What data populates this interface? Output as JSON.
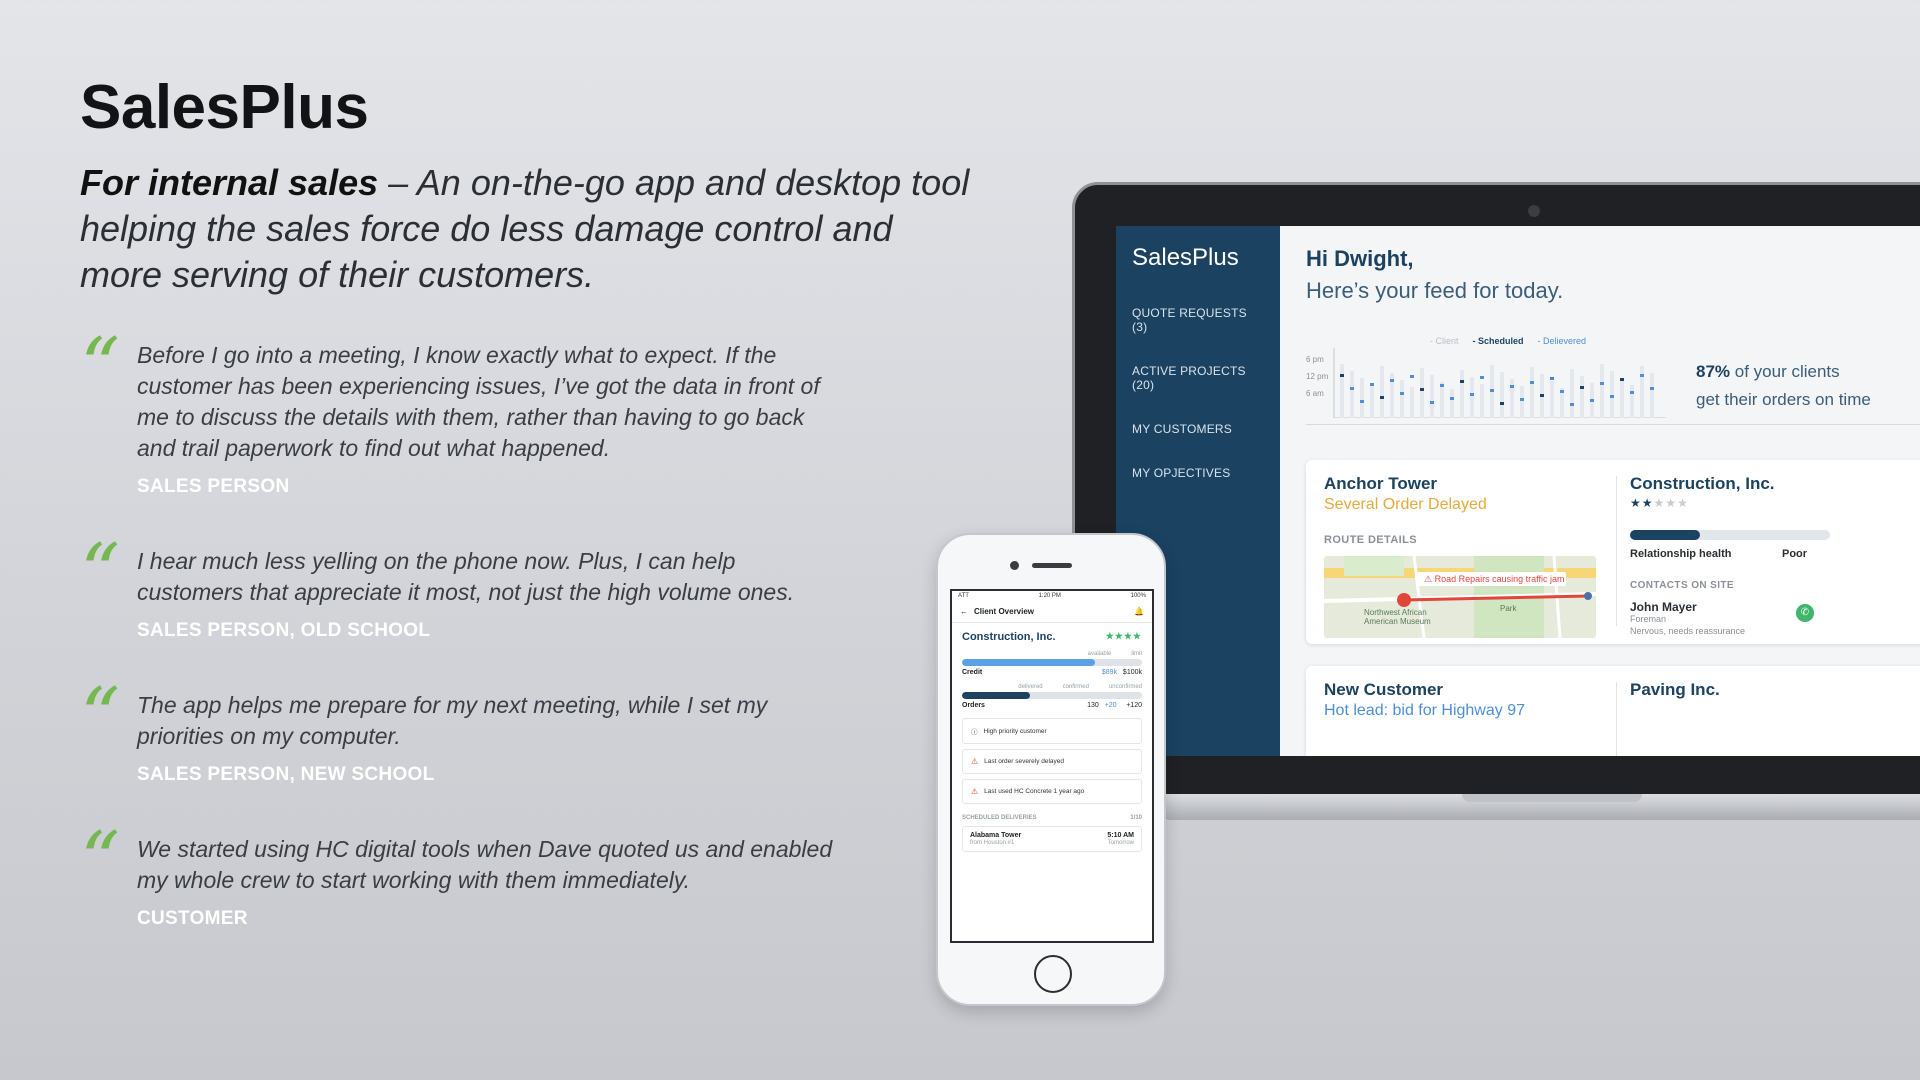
{
  "hero": {
    "title": "SalesPlus",
    "tagline_bold": "For internal sales",
    "tagline_rest": " – An on-the-go app and desktop tool helping the sales force do less damage control and more serving of their customers."
  },
  "quotes": [
    {
      "text": "Before I go into a meeting, I know exactly what to expect. If the customer has been experiencing issues, I’ve got the data in front of me to discuss the details with them, rather than having to go back and trail paperwork to find out what happened.",
      "author": "SALES PERSON"
    },
    {
      "text": "I hear much less yelling on the phone now. Plus, I can help customers that appreciate it most, not just the high volume ones.",
      "author": "SALES PERSON, OLD SCHOOL"
    },
    {
      "text": "The app helps me prepare for my next meeting, while I set my priorities on my computer.",
      "author": "SALES PERSON, NEW SCHOOL"
    },
    {
      "text": "We started using HC digital tools when Dave quoted us and enabled my whole crew to start working with them immediately.",
      "author": "CUSTOMER"
    }
  ],
  "desktop": {
    "brand": "SalesPlus",
    "nav": [
      "QUOTE REQUESTS (3)",
      "ACTIVE PROJECTS (20)",
      "MY CUSTOMERS",
      "MY OPJECTIVES"
    ],
    "greeting": "Hi Dwight,",
    "subgreeting": "Here’s your feed for today.",
    "legend": {
      "client": "Client",
      "scheduled": "Scheduled",
      "delivered": "Delievered"
    },
    "yticks": [
      "6 pm",
      "12 pm",
      "6 am"
    ],
    "stat_value": "87%",
    "stat_text1": " of your clients",
    "stat_text2": "get their orders on time",
    "card1": {
      "title": "Anchor Tower",
      "subtitle": "Several Order Delayed",
      "route_label": "ROUTE DETAILS",
      "map_alert": "Road Repairs causing traffic jam",
      "map_place1": "Northwest African American Museum",
      "map_place2": "Park",
      "right_title": "Construction, Inc.",
      "stars_filled": 2,
      "stars_total": 5,
      "health_label": "Relationship health",
      "health_value": "Poor",
      "health_fraction": 0.35,
      "contacts_label": "CONTACTS ON SITE",
      "contact_name": "John Mayer",
      "contact_role": "Foreman",
      "contact_note": "Nervous, needs reassurance"
    },
    "card2": {
      "title": "New Customer",
      "subtitle": "Hot lead: bid for Highway 97",
      "right_title": "Paving Inc."
    }
  },
  "phone": {
    "carrier": "ATT",
    "time": "1:20 PM",
    "battery": "100%",
    "header": "Client Overview",
    "company": "Construction, Inc.",
    "stars": "★★★★",
    "credit": {
      "label": "Credit",
      "cap1": "available",
      "cap2": "limit",
      "value1": "$89k",
      "value2": "$100k",
      "fraction": 0.74
    },
    "orders": {
      "label": "Orders",
      "cap1": "delivered",
      "cap2": "confirmed",
      "cap3": "unconfirmed",
      "value1": "130",
      "value2": "+20",
      "value3": "+120",
      "fraction": 0.38
    },
    "alerts": [
      "High priority customer",
      "Last order severely delayed",
      "Last used HC Concrete 1 year ago"
    ],
    "scheduled_label": "SCHEDULED DELIVERIES",
    "scheduled_count": "1/10",
    "delivery": {
      "name": "Alabama Tower",
      "from": "from Houston #1",
      "time": "5:10 AM",
      "day": "Tomorrow"
    }
  },
  "colors": {
    "accent_green": "#74b84f",
    "navy": "#1c4261",
    "orange": "#e6a93d",
    "blue": "#4d8fd6"
  }
}
